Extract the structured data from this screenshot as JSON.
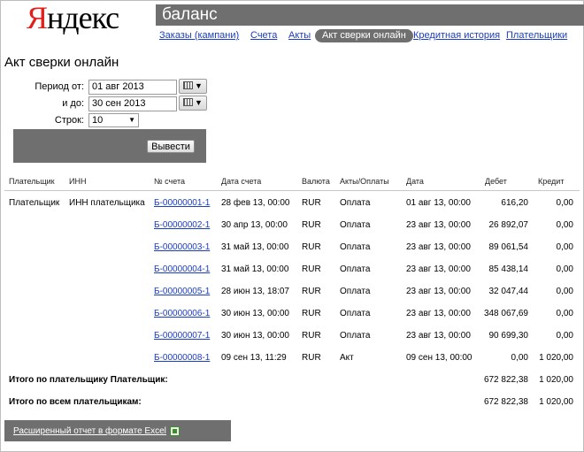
{
  "logo": {
    "first_letter": "Я",
    "rest": "ндекс"
  },
  "search": {
    "query": "баланс"
  },
  "nav": {
    "tabs": [
      {
        "label": "Заказы (кампани)",
        "active": false
      },
      {
        "label": "Счета",
        "active": false
      },
      {
        "label": "Акты",
        "active": false
      },
      {
        "label": "Акт сверки онлайн",
        "active": true
      },
      {
        "label": "Кредитная история",
        "active": false
      },
      {
        "label": "Плательщики",
        "active": false
      }
    ]
  },
  "page_title": "Акт сверки онлайн",
  "filters": {
    "period_from_label": "Период от:",
    "period_from_value": "01 авг 2013",
    "period_to_label": "и до:",
    "period_to_value": "30 сен 2013",
    "rows_label": "Строк:",
    "rows_value": "10",
    "submit_label": "Вывести"
  },
  "table": {
    "headers": [
      "Плательщик",
      "ИНН",
      "№ счета",
      "Дата счета",
      "Валюта",
      "Акты/Оплаты",
      "Дата",
      "Дебет",
      "Кредит"
    ],
    "payer": "Плательщик",
    "inn": "ИНН плательщика",
    "rows": [
      {
        "invoice": "Б-00000001-1",
        "invoice_date": "28 фев 13, 00:00",
        "currency": "RUR",
        "type": "Оплата",
        "date": "01 авг 13, 00:00",
        "debit": "616,20",
        "credit": "0,00"
      },
      {
        "invoice": "Б-00000002-1",
        "invoice_date": "30 апр 13, 00:00",
        "currency": "RUR",
        "type": "Оплата",
        "date": "23 авг 13, 00:00",
        "debit": "26 892,07",
        "credit": "0,00"
      },
      {
        "invoice": "Б-00000003-1",
        "invoice_date": "31 май 13, 00:00",
        "currency": "RUR",
        "type": "Оплата",
        "date": "23 авг 13, 00:00",
        "debit": "89 061,54",
        "credit": "0,00"
      },
      {
        "invoice": "Б-00000004-1",
        "invoice_date": "31 май 13, 00:00",
        "currency": "RUR",
        "type": "Оплата",
        "date": "23 авг 13, 00:00",
        "debit": "85 438,14",
        "credit": "0,00"
      },
      {
        "invoice": "Б-00000005-1",
        "invoice_date": "28 июн 13, 18:07",
        "currency": "RUR",
        "type": "Оплата",
        "date": "23 авг 13, 00:00",
        "debit": "32 047,44",
        "credit": "0,00"
      },
      {
        "invoice": "Б-00000006-1",
        "invoice_date": "30 июн 13, 00:00",
        "currency": "RUR",
        "type": "Оплата",
        "date": "23 авг 13, 00:00",
        "debit": "348 067,69",
        "credit": "0,00"
      },
      {
        "invoice": "Б-00000007-1",
        "invoice_date": "30 июн 13, 00:00",
        "currency": "RUR",
        "type": "Оплата",
        "date": "23 авг 13, 00:00",
        "debit": "90 699,30",
        "credit": "0,00"
      },
      {
        "invoice": "Б-00000008-1",
        "invoice_date": "09 сен 13, 11:29",
        "currency": "RUR",
        "type": "Акт",
        "date": "09 сен 13, 00:00",
        "debit": "0,00",
        "credit": "1 020,00"
      }
    ],
    "total_payer_label": "Итого по плательщику Плательщик:",
    "total_payer_debit": "672 822,38",
    "total_payer_credit": "1 020,00",
    "total_all_label": "Итого по всем плательщикам:",
    "total_all_debit": "672 822,38",
    "total_all_credit": "1 020,00"
  },
  "excel": {
    "link_label": "Расширенный отчет в формате Excel"
  },
  "icons": {
    "calendar": "calendar-grid-icon",
    "dropdown": "chevron-down-icon",
    "excel": "excel-file-icon"
  },
  "colors": {
    "logo_red": "#e0201b",
    "panel_gray": "#6f6f6f",
    "link_blue": "#1a3dc1"
  }
}
